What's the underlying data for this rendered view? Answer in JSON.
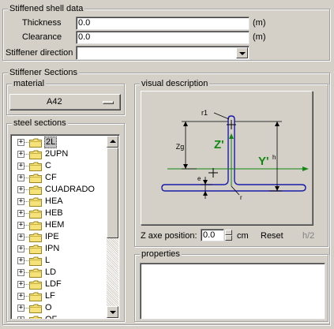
{
  "shell": {
    "title": "Stiffened shell data",
    "thickness_label": "Thickness",
    "thickness_value": "0.0",
    "thickness_unit": "(m)",
    "clearance_label": "Clearance",
    "clearance_value": "0.0",
    "clearance_unit": "(m)",
    "direction_label": "Stiffener direction",
    "direction_value": ""
  },
  "sections": {
    "title": "Stiffener Sections",
    "material_title": "material",
    "material_value": "A42",
    "steel_title": "steel sections",
    "steel_items": [
      "2L",
      "2UPN",
      "C",
      "CF",
      "CUADRADO",
      "HEA",
      "HEB",
      "HEM",
      "IPE",
      "IPN",
      "L",
      "LD",
      "LDF",
      "LF",
      "O",
      "OF"
    ],
    "selected_index": 0
  },
  "visual": {
    "title": "visual description",
    "labels": {
      "r1": "r1",
      "zg": "Zg",
      "z": "Z'",
      "y": "Y'",
      "e": "e",
      "h": "h",
      "r": "r"
    },
    "colors": {
      "outline": "#1a1aa8",
      "axis": "#118811",
      "dim": "#000000"
    },
    "z_axe_label": "Z axe position:",
    "z_axe_value": "0.0",
    "z_axe_unit": "cm",
    "reset_label": "Reset",
    "h2_label": "h/2"
  },
  "properties": {
    "title": "properties"
  }
}
